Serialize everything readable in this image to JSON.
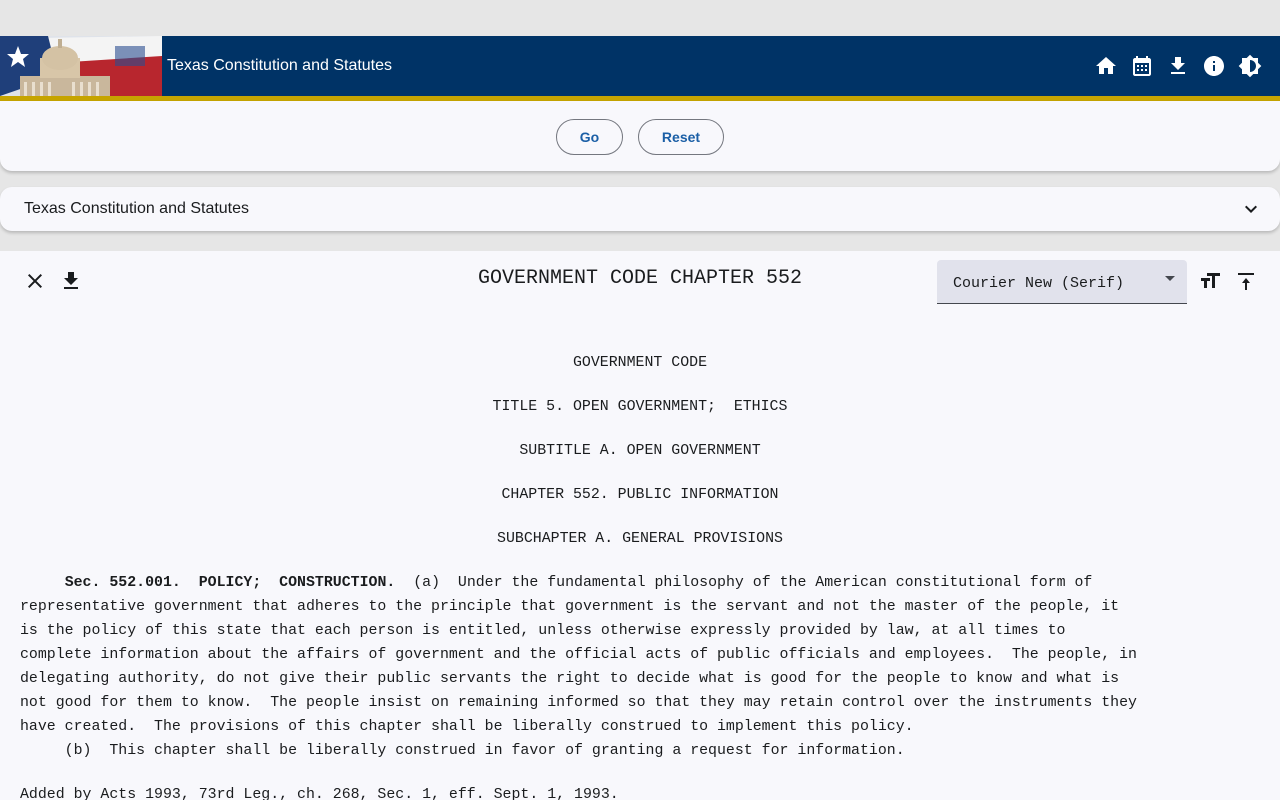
{
  "header": {
    "title": "Texas Constitution and Statutes",
    "background_color": "#003366",
    "accent_color": "#c6a400",
    "icons": [
      "home-icon",
      "calendar-icon",
      "download-icon",
      "info-icon",
      "brightness-icon"
    ]
  },
  "search": {
    "go_label": "Go",
    "reset_label": "Reset"
  },
  "expansion": {
    "title": "Texas Constitution and Statutes"
  },
  "document": {
    "heading": "GOVERNMENT CODE CHAPTER 552",
    "font_select": {
      "selected": "Courier New (Serif)"
    },
    "headings": [
      "GOVERNMENT CODE",
      "TITLE 5. OPEN GOVERNMENT;  ETHICS",
      "SUBTITLE A. OPEN GOVERNMENT",
      "CHAPTER 552. PUBLIC INFORMATION",
      "SUBCHAPTER A. GENERAL PROVISIONS"
    ],
    "section": {
      "indent": "     ",
      "label": "Sec. 552.001.  POLICY;  CONSTRUCTION.",
      "first_line_rest": "  (a)  Under the fundamental philosophy of the American constitutional form of",
      "lines": [
        "representative government that adheres to the principle that government is the servant and not the master of the people, it",
        "is the policy of this state that each person is entitled, unless otherwise expressly provided by law, at all times to",
        "complete information about the affairs of government and the official acts of public officials and employees.  The people, in",
        "delegating authority, do not give their public servants the right to decide what is good for the people to know and what is",
        "not good for them to know.  The people insist on remaining informed so that they may retain control over the instruments they",
        "have created.  The provisions of this chapter shall be liberally construed to implement this policy.",
        "     (b)  This chapter shall be liberally construed in favor of granting a request for information."
      ]
    },
    "added_note": "Added by Acts 1993, 73rd Leg., ch. 268, Sec. 1, eff. Sept. 1, 1993."
  }
}
